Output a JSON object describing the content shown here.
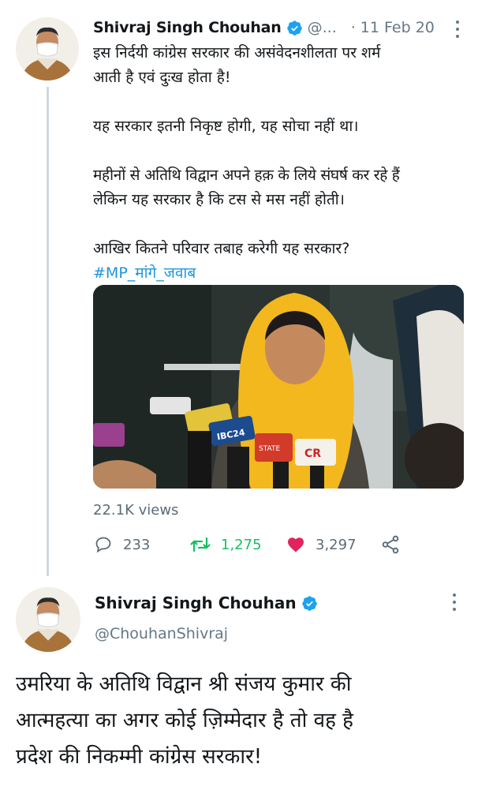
{
  "tweet1": {
    "author_name": "Shivraj Singh Chouhan",
    "handle": "@...",
    "date_separator": "·",
    "date": "11 Feb 20",
    "paragraphs": [
      [
        "इस निर्दयी कांग्रेस सरकार की असंवेदनशीलता पर शर्म",
        "आती है एवं दुःख होता है!"
      ],
      [
        "यह सरकार इतनी निकृष्ट होगी, यह सोचा नहीं था।"
      ],
      [
        "महीनों से अतिथि विद्वान अपने हक़ के लिये संघर्ष कर रहे हैं",
        "लेकिन यह सरकार है कि टस से मस नहीं होती।"
      ],
      [
        "आखिर कितने परिवार तबाह करेगी यह सरकार?"
      ]
    ],
    "hashtag": "#MP_मांगे_जवाब",
    "views": "22.1K views",
    "reply_count": "233",
    "retweet_count": "1,275",
    "like_count": "3,297",
    "media_mic_labels": [
      "IBC24",
      "STATE",
      "CR"
    ],
    "colors": {
      "retweet": "#17bf63",
      "like": "#e0245e",
      "hashtag": "#1b95e0",
      "verified": "#1da1f2"
    }
  },
  "tweet2": {
    "author_name": "Shivraj Singh Chouhan",
    "handle": "@ChouhanShivraj",
    "lines": [
      "उमरिया के अतिथि विद्वान श्री संजय कुमार की",
      "आत्महत्या का अगर कोई ज़िम्मेदार है तो वह है",
      "प्रदेश की निकम्मी कांग्रेस सरकार!"
    ]
  },
  "icons": {
    "verified": "verified-badge-icon",
    "menu": "more-options-icon",
    "reply": "reply-icon",
    "retweet": "retweet-icon",
    "like": "heart-icon",
    "share": "share-icon"
  }
}
